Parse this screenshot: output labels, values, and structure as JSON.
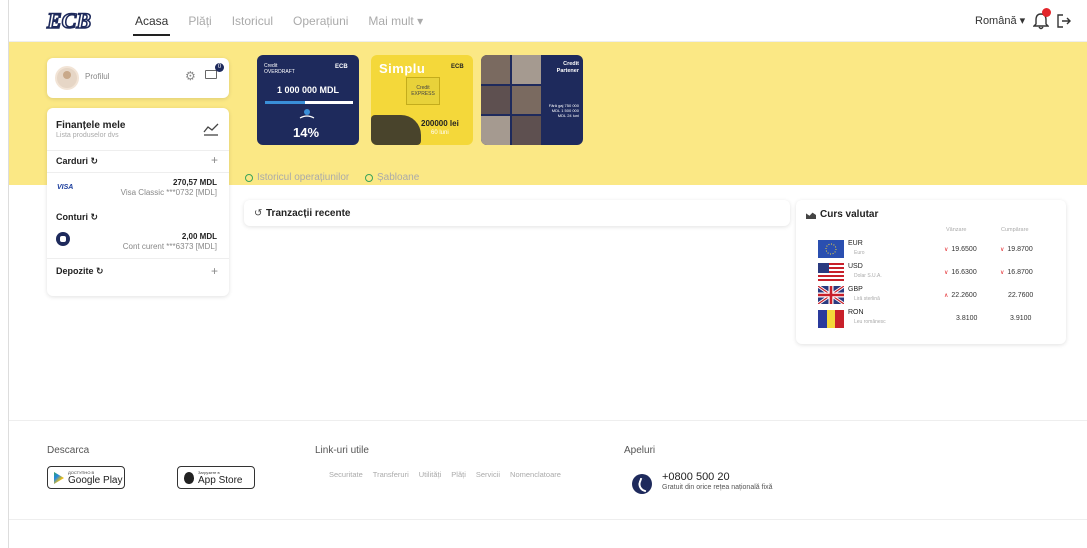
{
  "header": {
    "nav": [
      "Acasa",
      "Plăți",
      "Istoricul",
      "Operațiuni",
      "Mai mult ▾"
    ],
    "language": "Română ▾"
  },
  "profile": {
    "label": "Profilul",
    "mail_count": "0"
  },
  "finances": {
    "title": "Finanțele mele",
    "subtitle": "Lista produselor dvs",
    "cards_label": "Carduri ↻",
    "card_brand": "VISA",
    "card_amount": "270,57 MDL",
    "card_desc": "Visa Classic ***0732 [MDL]",
    "accounts_label": "Conturi ↻",
    "account_amount": "2,00 MDL",
    "account_desc": "Cont curent ***6373 [MDL]",
    "deposits_label": "Depozite ↻"
  },
  "promos": {
    "p1_label": "Credit OVERDRAFT",
    "p1_brand": "ECB",
    "p1_amount": "1 000 000 MDL",
    "p1_percent": "14%",
    "p1_progress": 0.45,
    "p2_title": "Simplu",
    "p2_brand": "ECB",
    "p2_box": "Credit EXPRESS",
    "p2_amount": "200000 lei",
    "p2_sub": "60 luni",
    "p3_title": "Credit Partener",
    "p3_text": "Fără gaj 750 000 MDL 1 500 000 MDL 24 luni"
  },
  "links": {
    "history": "Istoricul operațiunilor",
    "templates": "Șabloane"
  },
  "transactions": {
    "title": "Tranzacții recente"
  },
  "currency": {
    "title": "Curs valutar",
    "col_sell": "Vânzare",
    "col_buy": "Cumpărare",
    "rows": [
      {
        "code": "EUR",
        "name": "Euro",
        "sell": "19.6500",
        "buy": "19.8700",
        "sell_dir": "down",
        "buy_dir": "down"
      },
      {
        "code": "USD",
        "name": "Dolar S.U.A.",
        "sell": "16.6300",
        "buy": "16.8700",
        "sell_dir": "down",
        "buy_dir": "down"
      },
      {
        "code": "GBP",
        "name": "Liră sterlină",
        "sell": "22.2600",
        "buy": "22.7600",
        "sell_dir": "up",
        "buy_dir": "none"
      },
      {
        "code": "RON",
        "name": "Leu românesc",
        "sell": "3.8100",
        "buy": "3.9100",
        "sell_dir": "none",
        "buy_dir": "none"
      }
    ]
  },
  "footer": {
    "download": "Descarca",
    "gp_small": "ДОСТУПНО В",
    "gp_big": "Google Play",
    "as_small": "Загрузите в",
    "as_big": "App Store",
    "useful_links": "Link-uri utile",
    "links": [
      "Securitate",
      "Transferuri",
      "Utilități",
      "Plăți",
      "Servicii",
      "Nomenclatoare"
    ],
    "calls": "Apeluri",
    "phone": "+0800 500 20",
    "phone_sub": "Gratuit din orice rețea națională fixă"
  },
  "colors": {
    "hero": "#fbe885",
    "brand_navy": "#1e2a5c",
    "alert_red": "#e3262b"
  }
}
